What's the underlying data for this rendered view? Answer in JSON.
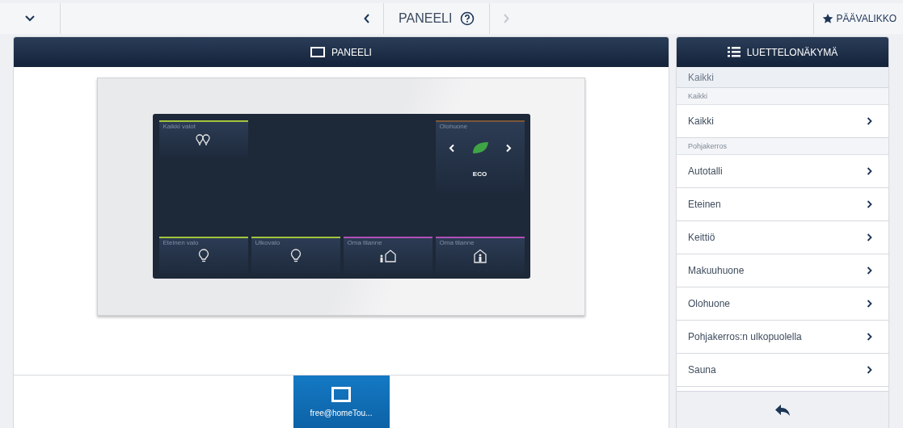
{
  "top_bar": {
    "title": "PANEELI",
    "prev_disabled": false,
    "next_disabled": true,
    "main_menu": "PÄÄVALIKKO"
  },
  "panel": {
    "title": "PANEELI",
    "tiles": [
      {
        "kind": "all-lights",
        "label": "Kaikki valot",
        "color": "#a3c43c"
      },
      {
        "kind": "thermostat",
        "label": "Olohuone",
        "color": "#7a5638",
        "mode": "ECO"
      },
      {
        "kind": "light",
        "label": "Eteinen valo",
        "color": "#a3c43c"
      },
      {
        "kind": "light",
        "label": "Ulkovalo",
        "color": "#a3c43c"
      },
      {
        "kind": "scene-out",
        "label": "Oma tilanne",
        "color": "#b04fb8"
      },
      {
        "kind": "scene-home",
        "label": "Oma tilanne",
        "color": "#b04fb8"
      }
    ],
    "devices": [
      {
        "label": "free@homeTou...",
        "selected": true
      }
    ]
  },
  "list": {
    "title": "LUETTELONÄKYMÄ",
    "breadcrumb": "Kaikki",
    "groups": [
      {
        "heading": "Kaikki",
        "items": [
          "Kaikki"
        ]
      },
      {
        "heading": "Pohjakerros",
        "items": [
          "Autotalli",
          "Eteinen",
          "Keittiö",
          "Makuuhuone",
          "Olohuone",
          "Pohjakerros:n ulkopuolella",
          "Sauna"
        ]
      }
    ]
  }
}
